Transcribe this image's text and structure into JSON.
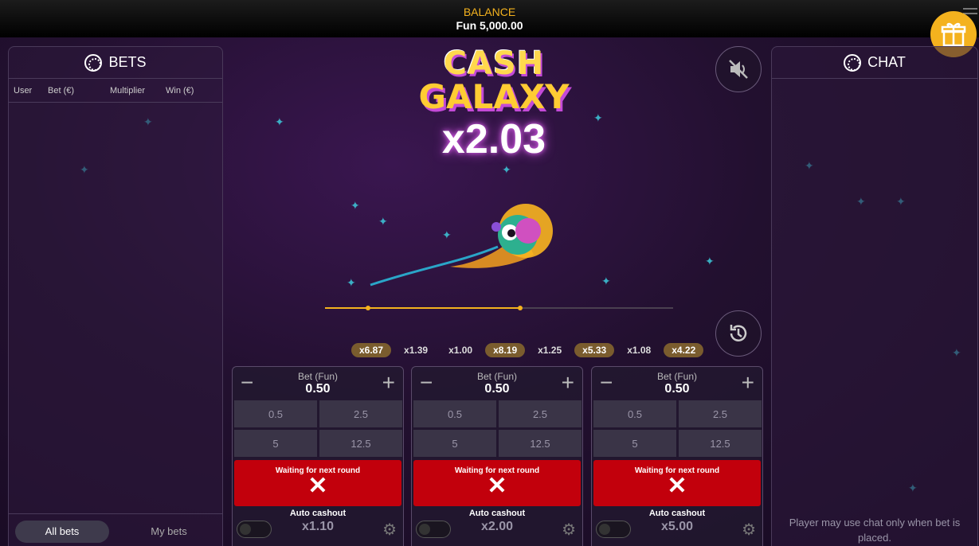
{
  "header": {
    "balance_label": "BALANCE",
    "balance_value": "Fun 5,000.00"
  },
  "bets_panel": {
    "title": "BETS",
    "columns": [
      "User",
      "Bet (€)",
      "Multiplier",
      "Win (€)"
    ],
    "tabs": {
      "all": "All bets",
      "my": "My bets"
    }
  },
  "chat_panel": {
    "title": "CHAT",
    "note": "Player may use chat only when bet is placed."
  },
  "game": {
    "logo_line1": "CASH",
    "logo_line2": "GALAXY",
    "multiplier": "x2.03",
    "history": [
      "x6.87",
      "x1.39",
      "x1.00",
      "x8.19",
      "x1.25",
      "x5.33",
      "x1.08",
      "x4.22"
    ]
  },
  "bet_cards": [
    {
      "label": "Bet (Fun)",
      "value": "0.50",
      "quick": [
        "0.5",
        "2.5",
        "5",
        "12.5"
      ],
      "action": "Waiting for next round",
      "auto_label": "Auto cashout",
      "auto_value": "x1.10"
    },
    {
      "label": "Bet (Fun)",
      "value": "0.50",
      "quick": [
        "0.5",
        "2.5",
        "5",
        "12.5"
      ],
      "action": "Waiting for next round",
      "auto_label": "Auto cashout",
      "auto_value": "x2.00"
    },
    {
      "label": "Bet (Fun)",
      "value": "0.50",
      "quick": [
        "0.5",
        "2.5",
        "5",
        "12.5"
      ],
      "action": "Waiting for next round",
      "auto_label": "Auto cashout",
      "auto_value": "x5.00"
    }
  ],
  "colors": {
    "accent": "#f4b21e",
    "cancel": "#c2000c",
    "glow": "#c44ad8"
  },
  "icons": [
    "gift-icon",
    "menu-icon",
    "chip-icon",
    "mute-icon",
    "history-icon",
    "minus-icon",
    "plus-icon",
    "close-icon",
    "gear-icon"
  ]
}
